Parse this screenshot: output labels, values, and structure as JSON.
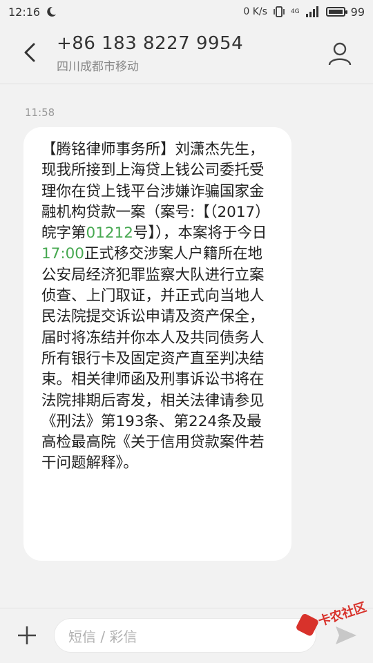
{
  "status_bar": {
    "time": "12:16",
    "net_speed": "0 K/s",
    "signal_label": "4G",
    "battery": "99"
  },
  "header": {
    "phone_number": "+86 183 8227 9954",
    "location": "四川成都市移动"
  },
  "conversation": {
    "time": "11:58",
    "message_parts": {
      "p1": "【腾铭律师事务所】刘潇杰先生，现我所接到上海贷上钱公司委托受理你在贷上钱平台涉嫌诈骗国家金融机构贷款一案（案号:【（2017）皖字第",
      "case_num": "01212",
      "p2": "号】），本案将于今日",
      "time": "17:00",
      "p3": "正式移交涉案人户籍所在地公安局经济犯罪监察大队进行立案侦查、上门取证，并正式向当地人民法院提交诉讼申请及资产保全，届时将冻结并你本人及共同债务人所有银行卡及固定资产直至判决结束。相关律师函及刑事诉讼书将在法院排期后寄发，相关法律请参见《刑法》第193条、第224条及最高检最高院《关于信用贷款案件若干问题解释》。"
    },
    "highlight_color": "#46a850"
  },
  "input_bar": {
    "placeholder": "短信 / 彩信"
  },
  "watermark": {
    "text": "卡农社区"
  }
}
